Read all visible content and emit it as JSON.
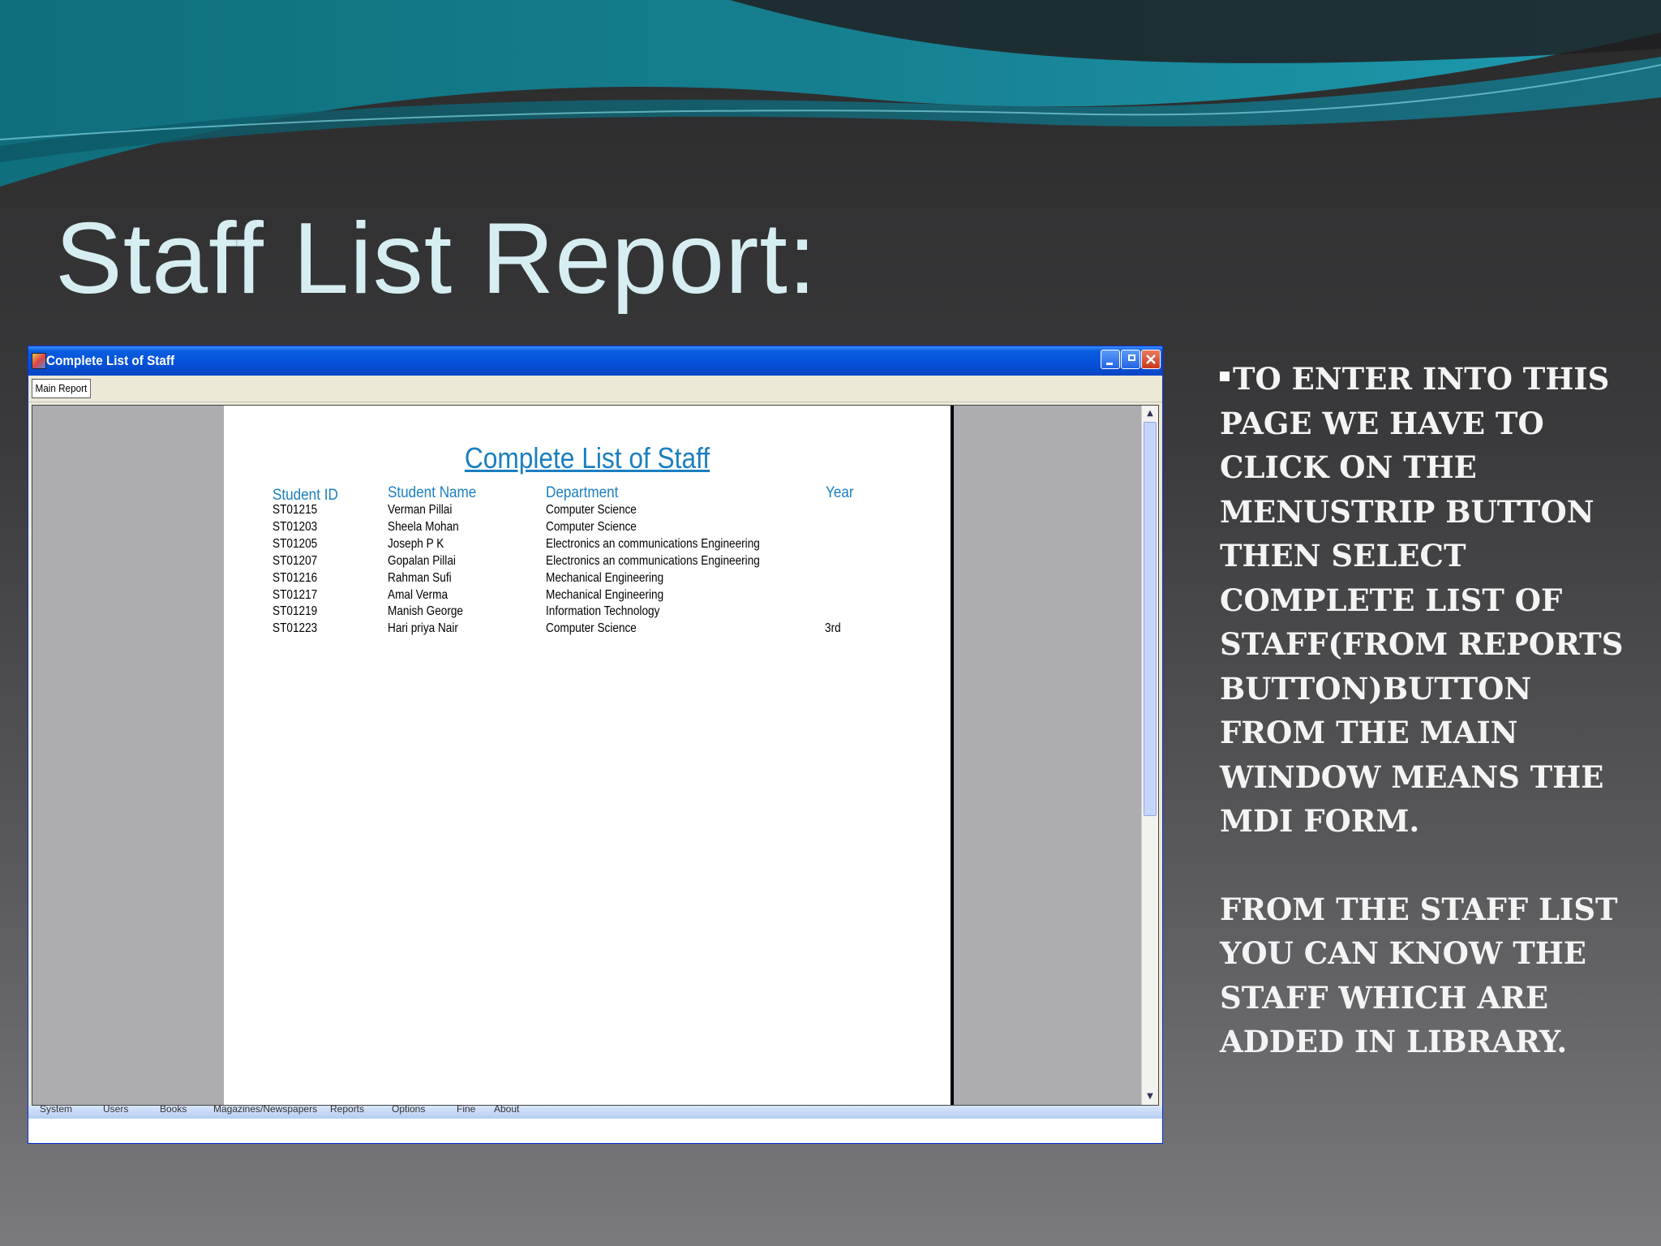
{
  "slide": {
    "title": "Staff List Report:"
  },
  "window": {
    "title": "Complete List of Staff",
    "menu": {
      "main_report_label": "Main Report"
    }
  },
  "report": {
    "title": "Complete List of Staff",
    "columns": [
      "Student ID",
      "Student Name",
      "Department",
      "Year"
    ],
    "rows": [
      [
        "ST01215",
        "Verman Pillai",
        "Computer Science",
        ""
      ],
      [
        "ST01203",
        "Sheela Mohan",
        "Computer Science",
        ""
      ],
      [
        "ST01205",
        "Joseph P K",
        "Electronics an communications Engineering",
        ""
      ],
      [
        "ST01207",
        "Gopalan Pillai",
        "Electronics an communications Engineering",
        ""
      ],
      [
        "ST01216",
        "Rahman Sufi",
        "Mechanical Engineering",
        ""
      ],
      [
        "ST01217",
        "Amal Verma",
        "Mechanical Engineering",
        ""
      ],
      [
        "ST01219",
        "Manish George",
        "Information Technology",
        ""
      ],
      [
        "ST01223",
        "Hari priya Nair",
        "Computer Science",
        "3rd"
      ]
    ]
  },
  "taskbar": {
    "items": [
      "System",
      "Users",
      "Books",
      "Magazines/Newspapers",
      "Reports",
      "Options",
      "Fine",
      "About"
    ]
  },
  "side_text": {
    "paragraph1": "To enter into this page we have to click on the Menustrip button then select Complete list of staff(from Reports button)button from the Main Window means the MDI Form.",
    "paragraph2": "From the Staff List you can know the staff which are added in library."
  },
  "colors": {
    "report_blue": "#1b7fbf",
    "titlebar_blue": "#0551d8",
    "title_text": "#d6eef2"
  }
}
